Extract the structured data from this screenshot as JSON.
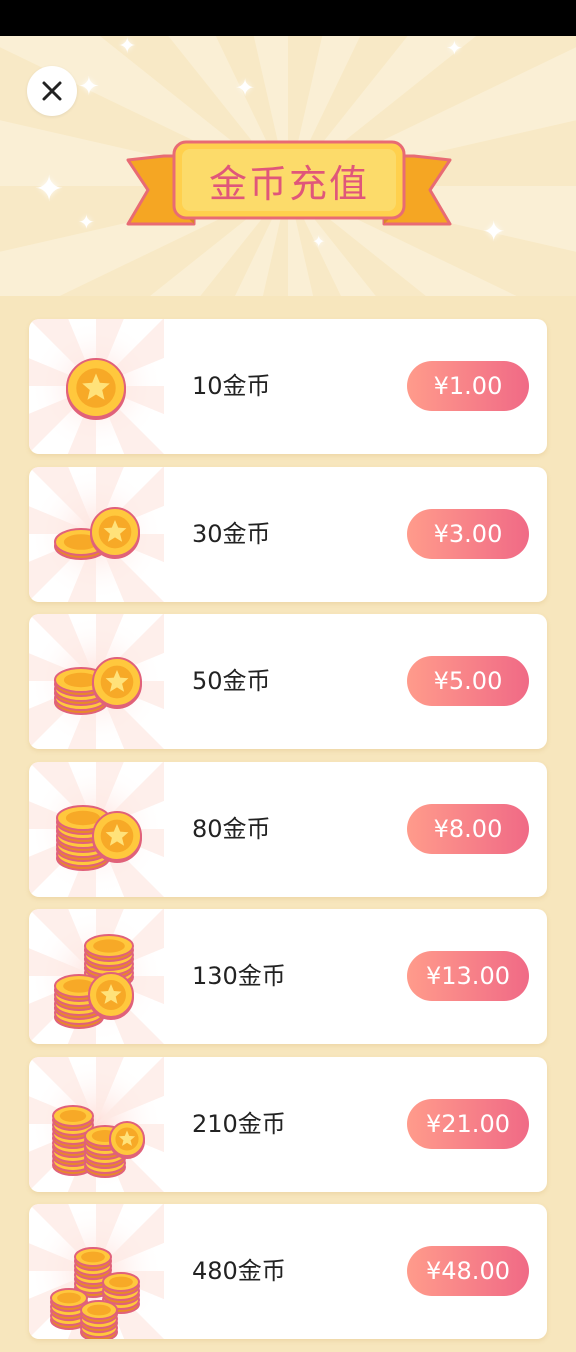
{
  "header": {
    "title": "金币充值"
  },
  "icons": {
    "close": "close-icon",
    "coin": "coin-icon",
    "sparkle": "sparkle-icon"
  },
  "colors": {
    "background": "#f7e6bd",
    "title_text": "#e0567a",
    "ribbon": "#f5b93a",
    "price_gradient_start": "#ff9b8b",
    "price_gradient_end": "#f06a86"
  },
  "packages": [
    {
      "label": "10金币",
      "price": "¥1.00",
      "coins": 1
    },
    {
      "label": "30金币",
      "price": "¥3.00",
      "coins": 2
    },
    {
      "label": "50金币",
      "price": "¥5.00",
      "coins": 3
    },
    {
      "label": "80金币",
      "price": "¥8.00",
      "coins": 4
    },
    {
      "label": "130金币",
      "price": "¥13.00",
      "coins": 5
    },
    {
      "label": "210金币",
      "price": "¥21.00",
      "coins": 6
    },
    {
      "label": "480金币",
      "price": "¥48.00",
      "coins": 7
    }
  ]
}
